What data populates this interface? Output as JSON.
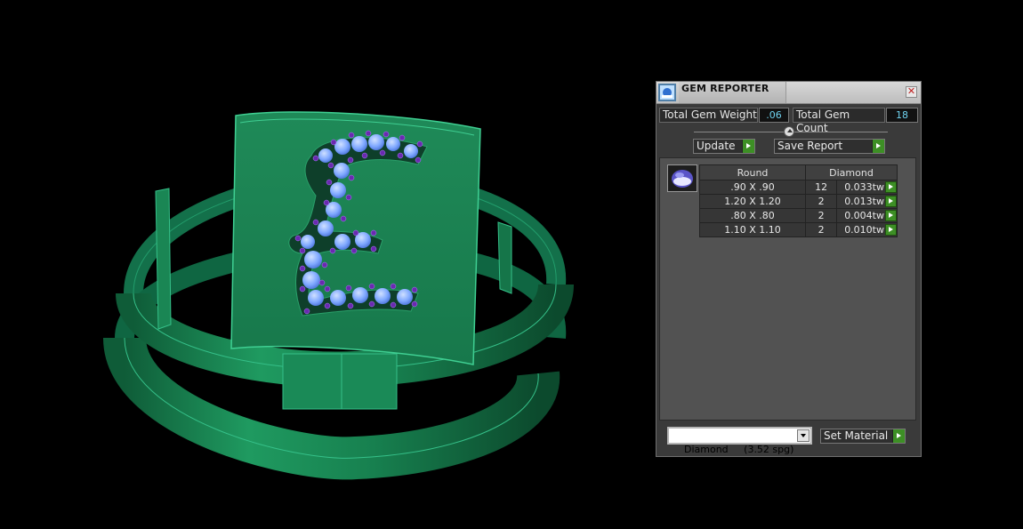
{
  "panel": {
    "title": "GEM REPORTER",
    "total_gem_weight_label": "Total Gem Weight",
    "total_gem_weight_value": ".06",
    "total_gem_count_label": "Total Gem Count",
    "total_gem_count_value": "18",
    "update_label": "Update",
    "save_report_label": "Save Report",
    "table": {
      "headers": [
        "Round",
        "Diamond"
      ],
      "rows": [
        {
          "size": ".90 X .90",
          "count": "12",
          "weight": "0.033tw"
        },
        {
          "size": "1.20 X 1.20",
          "count": "2",
          "weight": "0.013tw"
        },
        {
          "size": ".80 X .80",
          "count": "2",
          "weight": "0.004tw"
        },
        {
          "size": "1.10 X 1.10",
          "count": "2",
          "weight": "0.010tw"
        }
      ]
    },
    "material_selected": "Diamond     (3.52 spg)",
    "set_material_label": "Set Material"
  },
  "colors": {
    "ring_green": "#1f8f5a",
    "gem_blue": "#8fb8ff",
    "prong_purple": "#6a2ab0",
    "value_cyan": "#6fd3f0",
    "go_green": "#3d8f25"
  }
}
